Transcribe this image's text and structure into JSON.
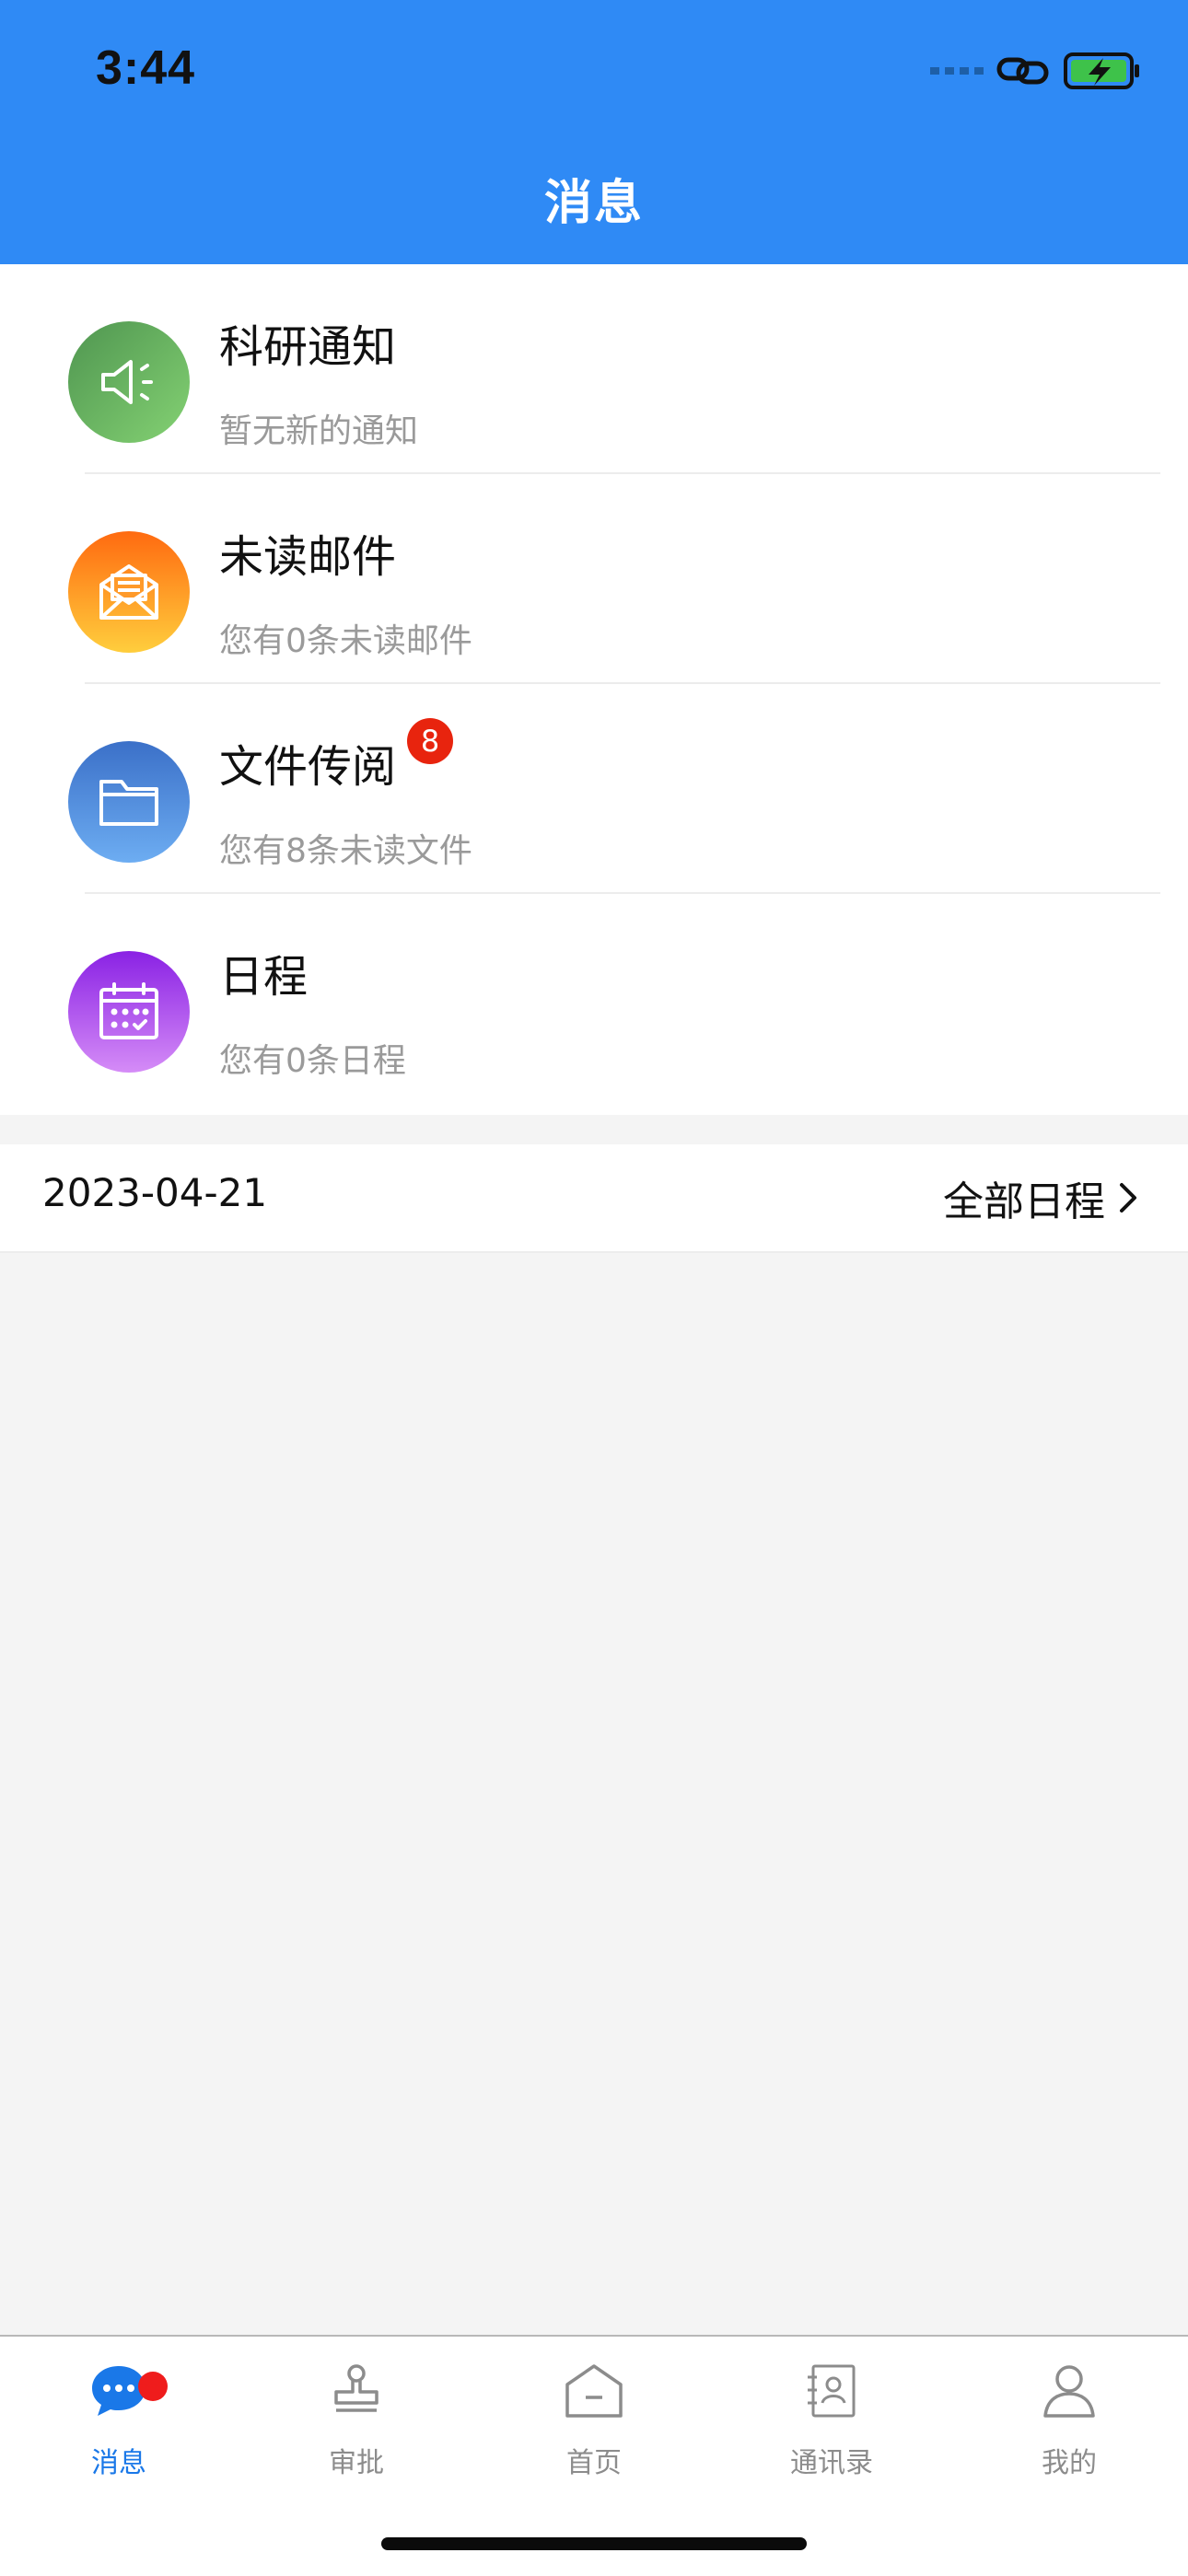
{
  "status_bar": {
    "time": "3:44"
  },
  "header": {
    "title": "消息"
  },
  "messages": [
    {
      "title": "科研通知",
      "subtitle": "暂无新的通知",
      "icon": "megaphone-icon",
      "gradient": [
        "#5a9e58",
        "#7fcf6e"
      ]
    },
    {
      "title": "未读邮件",
      "subtitle": "您有0条未读邮件",
      "icon": "mail-icon",
      "gradient": [
        "#ff6b12",
        "#ffc43a"
      ]
    },
    {
      "title": "文件传阅",
      "subtitle": "您有8条未读文件",
      "icon": "folder-icon",
      "gradient": [
        "#3f76cf",
        "#6aaaf0"
      ],
      "badge": "8"
    },
    {
      "title": "日程",
      "subtitle": "您有0条日程",
      "icon": "calendar-icon",
      "gradient": [
        "#8a28e6",
        "#d086f6"
      ]
    }
  ],
  "schedule": {
    "date": "2023-04-21",
    "all_label": "全部日程"
  },
  "tabbar": {
    "tabs": [
      {
        "label": "消息",
        "icon": "chat-icon",
        "active": true
      },
      {
        "label": "审批",
        "icon": "stamp-icon",
        "active": false
      },
      {
        "label": "首页",
        "icon": "home-icon",
        "active": false
      },
      {
        "label": "通讯录",
        "icon": "contacts-icon",
        "active": false
      },
      {
        "label": "我的",
        "icon": "profile-icon",
        "active": false
      }
    ]
  },
  "colors": {
    "brand": "#2f8af5",
    "active_tab": "#1a78e8",
    "badge": "#e8240e"
  }
}
